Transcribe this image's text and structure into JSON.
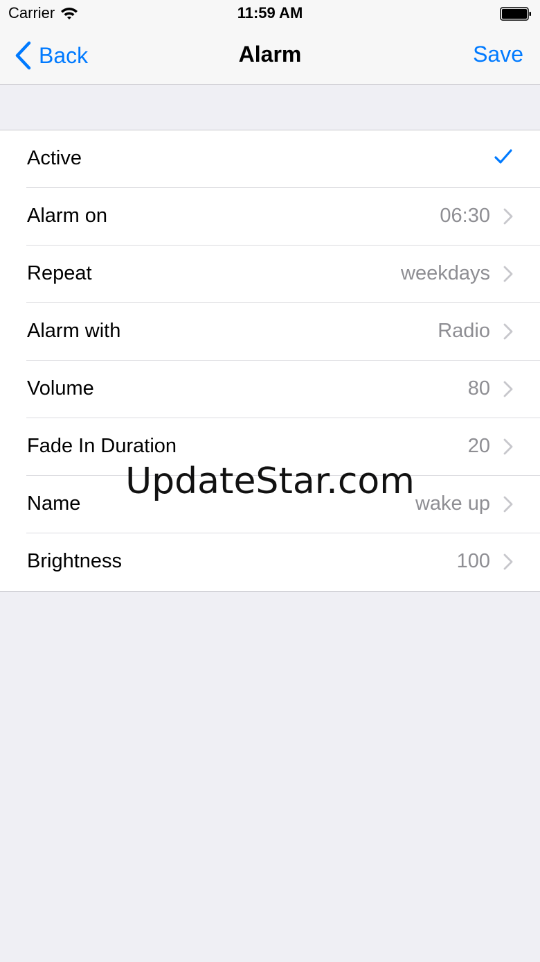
{
  "status_bar": {
    "carrier": "Carrier",
    "time": "11:59 AM",
    "wifi_icon": "wifi-icon",
    "battery_icon": "battery-icon"
  },
  "nav": {
    "back_label": "Back",
    "title": "Alarm",
    "save_label": "Save",
    "accent_color": "#007aff"
  },
  "settings": [
    {
      "label": "Active",
      "value": "",
      "accessory": "checkmark"
    },
    {
      "label": "Alarm on",
      "value": "06:30",
      "accessory": "chevron"
    },
    {
      "label": "Repeat",
      "value": "weekdays",
      "accessory": "chevron"
    },
    {
      "label": "Alarm with",
      "value": "Radio",
      "accessory": "chevron"
    },
    {
      "label": "Volume",
      "value": "80",
      "accessory": "chevron"
    },
    {
      "label": "Fade In Duration",
      "value": "20",
      "accessory": "chevron"
    },
    {
      "label": "Name",
      "value": "wake up",
      "accessory": "chevron"
    },
    {
      "label": "Brightness",
      "value": "100",
      "accessory": "chevron"
    }
  ],
  "watermark": "UpdateStar.com"
}
